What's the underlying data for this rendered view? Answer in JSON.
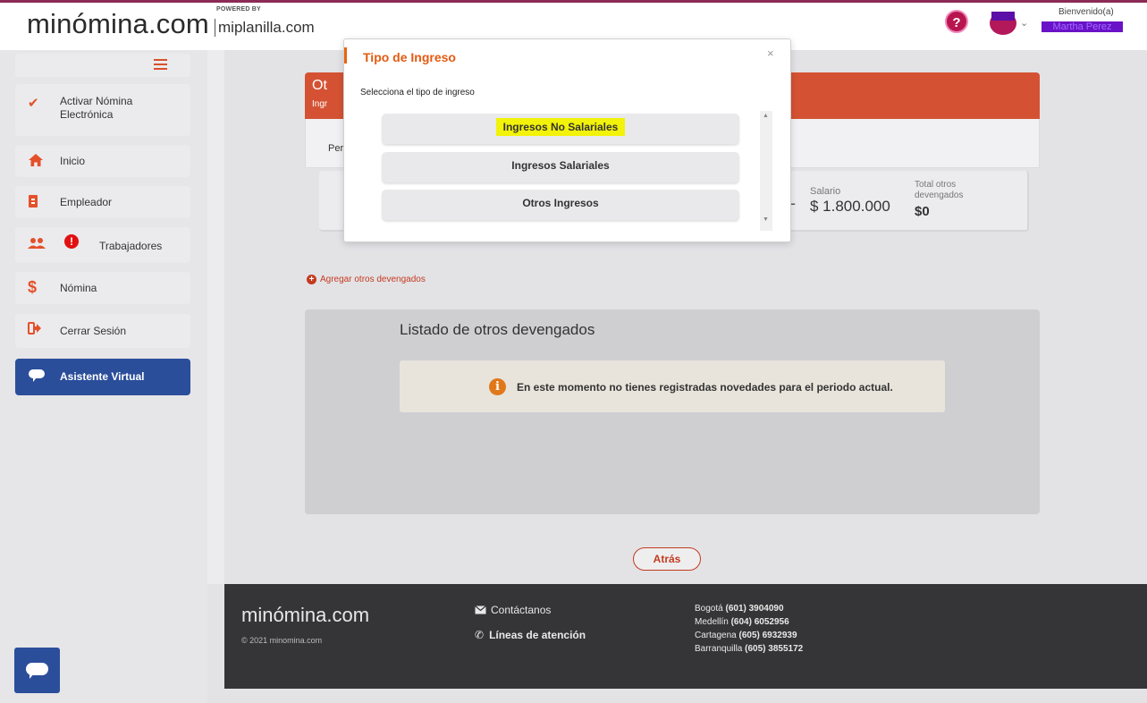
{
  "header": {
    "logo": "minómina.com",
    "powered_by": "POWERED BY",
    "partner": "miplanilla.com",
    "help_icon": "question-circle-icon",
    "welcome": "Bienvenido(a)",
    "username": "Martha Perez"
  },
  "sidebar": {
    "items": [
      {
        "label": "Activar Nómina Electrónica",
        "icon": "check-icon"
      },
      {
        "label": "Inicio",
        "icon": "home-icon"
      },
      {
        "label": "Empleador",
        "icon": "id-badge-icon"
      },
      {
        "label": "Trabajadores",
        "icon": "users-icon"
      },
      {
        "label": "Nómina",
        "icon": "dollar-icon"
      },
      {
        "label": "Cerrar Sesión",
        "icon": "sign-out-icon"
      },
      {
        "label": "Asistente Virtual",
        "icon": "chat-icon"
      }
    ]
  },
  "card": {
    "title": "Ot",
    "subtitle": "Ingr",
    "period_label": "Per"
  },
  "summary": {
    "dash": "-",
    "salary_label": "Salario",
    "salary_value": "$ 1.800.000",
    "total_label": "Total otros devengados",
    "total_value": "$0"
  },
  "add_link": "Agregar otros devengados",
  "list": {
    "title": "Listado de otros devengados",
    "notice": "En este momento no tienes registradas novedades para el periodo actual."
  },
  "back_button": "Atrás",
  "footer": {
    "logo": "minómina.com",
    "copyright": "© 2021 minomina.com",
    "contact": "Contáctanos",
    "lines": "Líneas de atención",
    "phones": [
      {
        "city": "Bogotá",
        "number": "(601) 3904090"
      },
      {
        "city": "Medellín",
        "number": "(604) 6052956"
      },
      {
        "city": "Cartagena",
        "number": "(605) 6932939"
      },
      {
        "city": "Barranquilla",
        "number": "(605) 3855172"
      }
    ]
  },
  "modal": {
    "title": "Tipo de Ingreso",
    "close": "×",
    "prompt": "Selecciona el tipo de ingreso",
    "options": [
      "Ingresos No Salariales",
      "Ingresos Salariales",
      "Otros Ingresos"
    ]
  },
  "colors": {
    "accent": "#d45233",
    "brand_blue": "#2b4e9b",
    "modal_title": "#e45a10",
    "highlight": "#f2f20a"
  }
}
